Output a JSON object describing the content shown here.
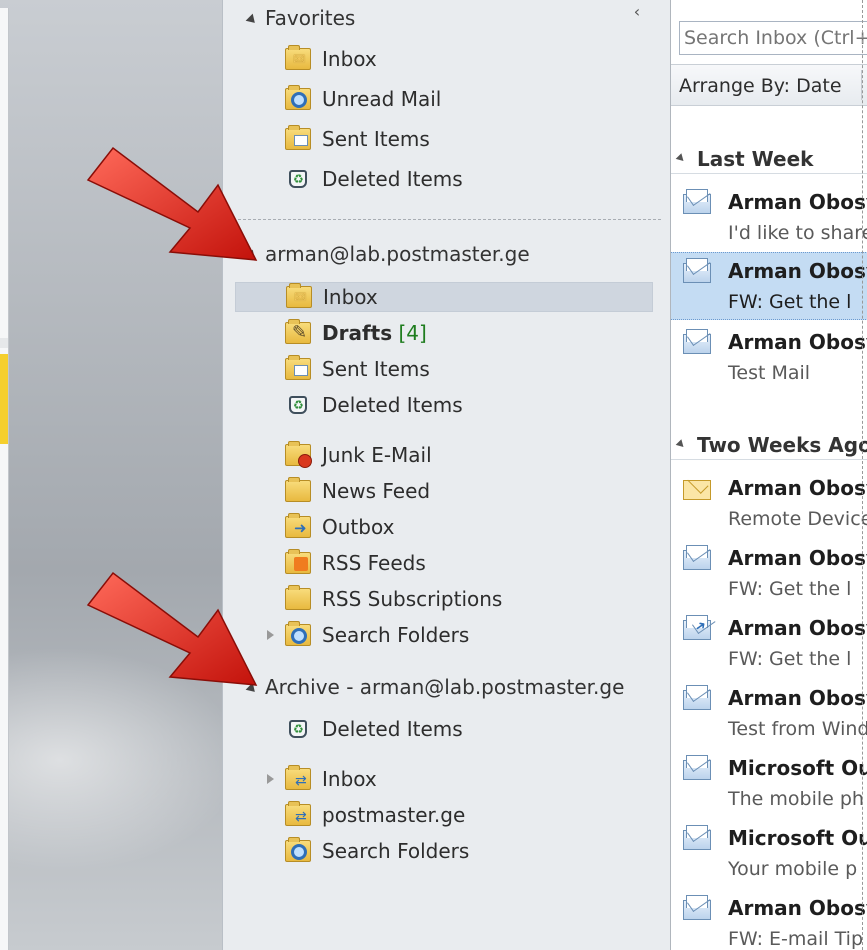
{
  "folder_pane": {
    "favorites": {
      "label": "Favorites",
      "items": [
        {
          "label": "Inbox",
          "icon": "inbox-folder-icon"
        },
        {
          "label": "Unread Mail",
          "icon": "search-folder-icon"
        },
        {
          "label": "Sent Items",
          "icon": "sent-items-icon"
        },
        {
          "label": "Deleted Items",
          "icon": "deleted-items-icon"
        }
      ]
    },
    "mailbox": {
      "label": "arman@lab.postmaster.ge",
      "items": [
        {
          "label": "Inbox",
          "icon": "inbox-folder-icon",
          "selected": true
        },
        {
          "label": "Drafts",
          "count": "[4]",
          "icon": "drafts-icon"
        },
        {
          "label": "Sent Items",
          "icon": "sent-items-icon"
        },
        {
          "label": "Deleted Items",
          "icon": "deleted-items-icon"
        },
        {
          "label": "Junk E-Mail",
          "icon": "junk-mail-icon"
        },
        {
          "label": "News Feed",
          "icon": "folder-icon"
        },
        {
          "label": "Outbox",
          "icon": "outbox-icon"
        },
        {
          "label": "RSS Feeds",
          "icon": "rss-feeds-icon"
        },
        {
          "label": "RSS Subscriptions",
          "icon": "folder-icon"
        },
        {
          "label": "Search Folders",
          "icon": "search-folder-icon"
        }
      ]
    },
    "archive": {
      "label": "Archive - arman@lab.postmaster.ge",
      "items": [
        {
          "label": "Deleted Items",
          "icon": "deleted-items-icon"
        },
        {
          "label": "Inbox",
          "icon": "sync-folder-icon"
        },
        {
          "label": "postmaster.ge",
          "icon": "sync-folder-icon"
        },
        {
          "label": "Search Folders",
          "icon": "search-folder-icon"
        }
      ]
    }
  },
  "message_list": {
    "search_placeholder": "Search Inbox (Ctrl+E)",
    "arrange_label": "Arrange By: Date",
    "groups": [
      {
        "label": "Last Week",
        "messages": [
          {
            "sender": "Arman Obosyan",
            "subject": "I'd like to share",
            "icon": "read-envelope-icon"
          },
          {
            "sender": "Arman Obosyan",
            "subject": "FW: Get the l",
            "icon": "read-envelope-icon",
            "selected": true
          },
          {
            "sender": "Arman Obosyan",
            "subject": "Test Mail",
            "icon": "read-envelope-icon"
          }
        ]
      },
      {
        "label": "Two Weeks Ago",
        "messages": [
          {
            "sender": "Arman Obosyan",
            "subject": "Remote Device",
            "icon": "unread-envelope-icon"
          },
          {
            "sender": "Arman Obosyan",
            "subject": "FW: Get the l",
            "icon": "read-envelope-icon"
          },
          {
            "sender": "Arman Obosyan",
            "subject": "FW: Get the l",
            "icon": "forwarded-envelope-icon"
          },
          {
            "sender": "Arman Obosyan",
            "subject": "Test from Windows",
            "icon": "read-envelope-icon"
          },
          {
            "sender": "Microsoft Outlook",
            "subject": "The mobile ph",
            "icon": "read-envelope-icon"
          },
          {
            "sender": "Microsoft Outlook",
            "subject": "Your mobile p",
            "icon": "read-envelope-icon"
          },
          {
            "sender": "Arman Obosyan",
            "subject": "FW: E-mail Tip",
            "icon": "read-envelope-icon"
          }
        ]
      }
    ]
  },
  "colors": {
    "arrow": "#e2231a",
    "selection": "#c4dcf3",
    "folder_selection": "#cfd6df",
    "count": "#1f7d1f"
  }
}
